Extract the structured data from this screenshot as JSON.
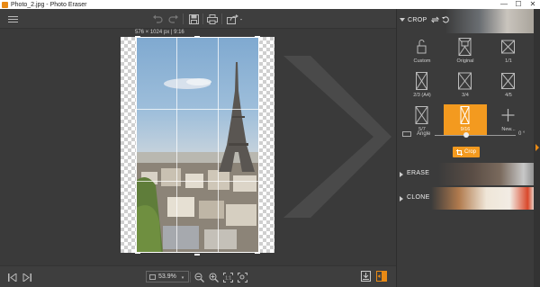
{
  "window": {
    "title": "Photo_2.jpg - Photo Eraser",
    "minimize": "—",
    "maximize": "☐",
    "close": "✕"
  },
  "toolbar": {
    "menu_icon": "hamburger-menu-icon",
    "undo_icon": "undo-icon",
    "redo_icon": "redo-icon",
    "save_icon": "save-icon",
    "print_icon": "print-icon",
    "share_icon": "share-icon"
  },
  "canvas": {
    "dimensions_label": "576 × 1024 px | 9:16"
  },
  "bottom": {
    "zoom_value": "53.9%"
  },
  "panel": {
    "crop_title": "CROP",
    "presets": [
      {
        "label": "Custom"
      },
      {
        "label": "Original"
      },
      {
        "label": "1/1"
      },
      {
        "label": "2/3 (A4)"
      },
      {
        "label": "3/4"
      },
      {
        "label": "4/5"
      },
      {
        "label": "5/7"
      },
      {
        "label": "9/16"
      },
      {
        "label": "New..."
      }
    ],
    "selected_preset": "9/16",
    "angle_label": "Angle",
    "angle_value": "0 °",
    "crop_button": "Crop",
    "erase_title": "ERASE",
    "clone_title": "CLONE"
  },
  "colors": {
    "accent": "#f39a1f",
    "panel_bg": "#3b3b3b",
    "canvas_bg": "#3a3a3a"
  }
}
